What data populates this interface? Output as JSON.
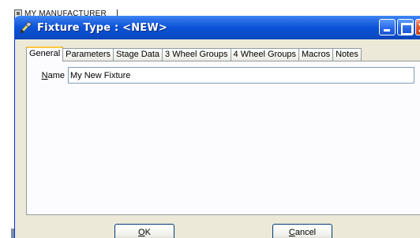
{
  "background": {
    "tree_item_label": "MY MANUFACTURER"
  },
  "window": {
    "title": "Fixture Type : <NEW>"
  },
  "tabs": [
    {
      "label": "General",
      "active": true
    },
    {
      "label": "Parameters",
      "active": false
    },
    {
      "label": "Stage Data",
      "active": false
    },
    {
      "label": "3 Wheel Groups",
      "active": false
    },
    {
      "label": "4 Wheel Groups",
      "active": false
    },
    {
      "label": "Macros",
      "active": false
    },
    {
      "label": "Notes",
      "active": false
    }
  ],
  "general": {
    "name_label": "Name",
    "name_value": "My New Fixture"
  },
  "buttons": {
    "ok_label": "OK",
    "cancel_label": "Cancel"
  },
  "colors": {
    "titlebar": "#0a52d8",
    "window_face": "#ece9d8",
    "active_tab_highlight": "#ffc83c",
    "close_button": "#e3582b"
  },
  "icons": {
    "title": "fixture-tool-icon",
    "tree": "tree-node-icon"
  }
}
